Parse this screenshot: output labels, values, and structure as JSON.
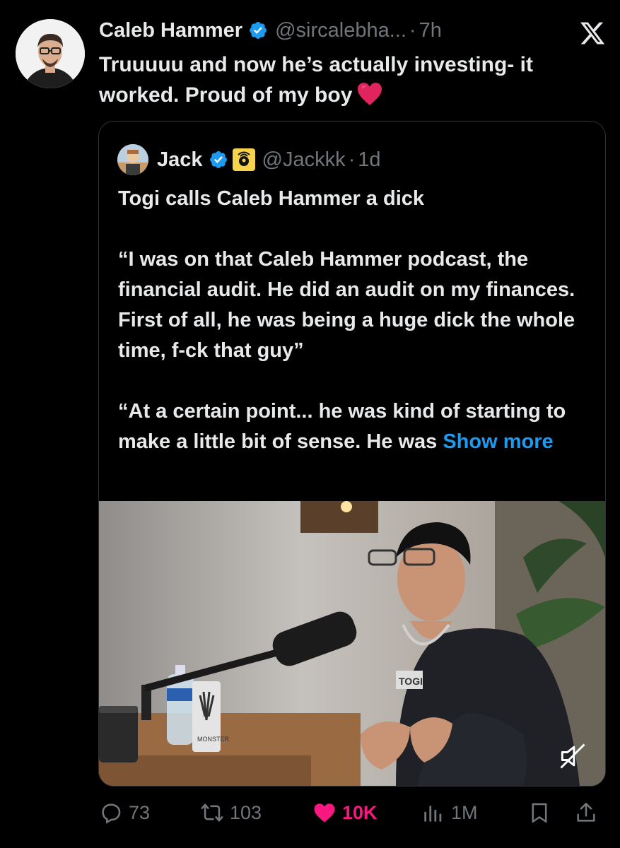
{
  "tweet": {
    "author_name": "Caleb Hammer",
    "handle": "@sircalebha...",
    "separator": "·",
    "time": "7h",
    "text": "Truuuuu and now he’s actually investing- it worked. Proud of my boy",
    "emoji": "red-heart"
  },
  "quoted": {
    "author_name": "Jack",
    "handle": "@Jackkk",
    "separator": "·",
    "time": "1d",
    "text": "Togi calls Caleb Hammer a dick\n\n“I was on that Caleb Hammer podcast, the financial audit. He did an audit on my finances. First of all, he was being a huge dick the whole time, f-ck that guy”\n\n“At a certain point... he was kind of starting to make a little bit of sense. He was ",
    "show_more": "Show more",
    "media": {
      "type": "video",
      "shirt_text": "TOGI",
      "can_text": "MONSTER"
    }
  },
  "actions": {
    "replies": "73",
    "reposts": "103",
    "likes": "10K",
    "views": "1M"
  },
  "colors": {
    "background": "#000000",
    "text": "#e7e9ea",
    "muted": "#71767b",
    "link": "#1d9bf0",
    "like": "#f91880",
    "verified": "#1d9bf0"
  }
}
